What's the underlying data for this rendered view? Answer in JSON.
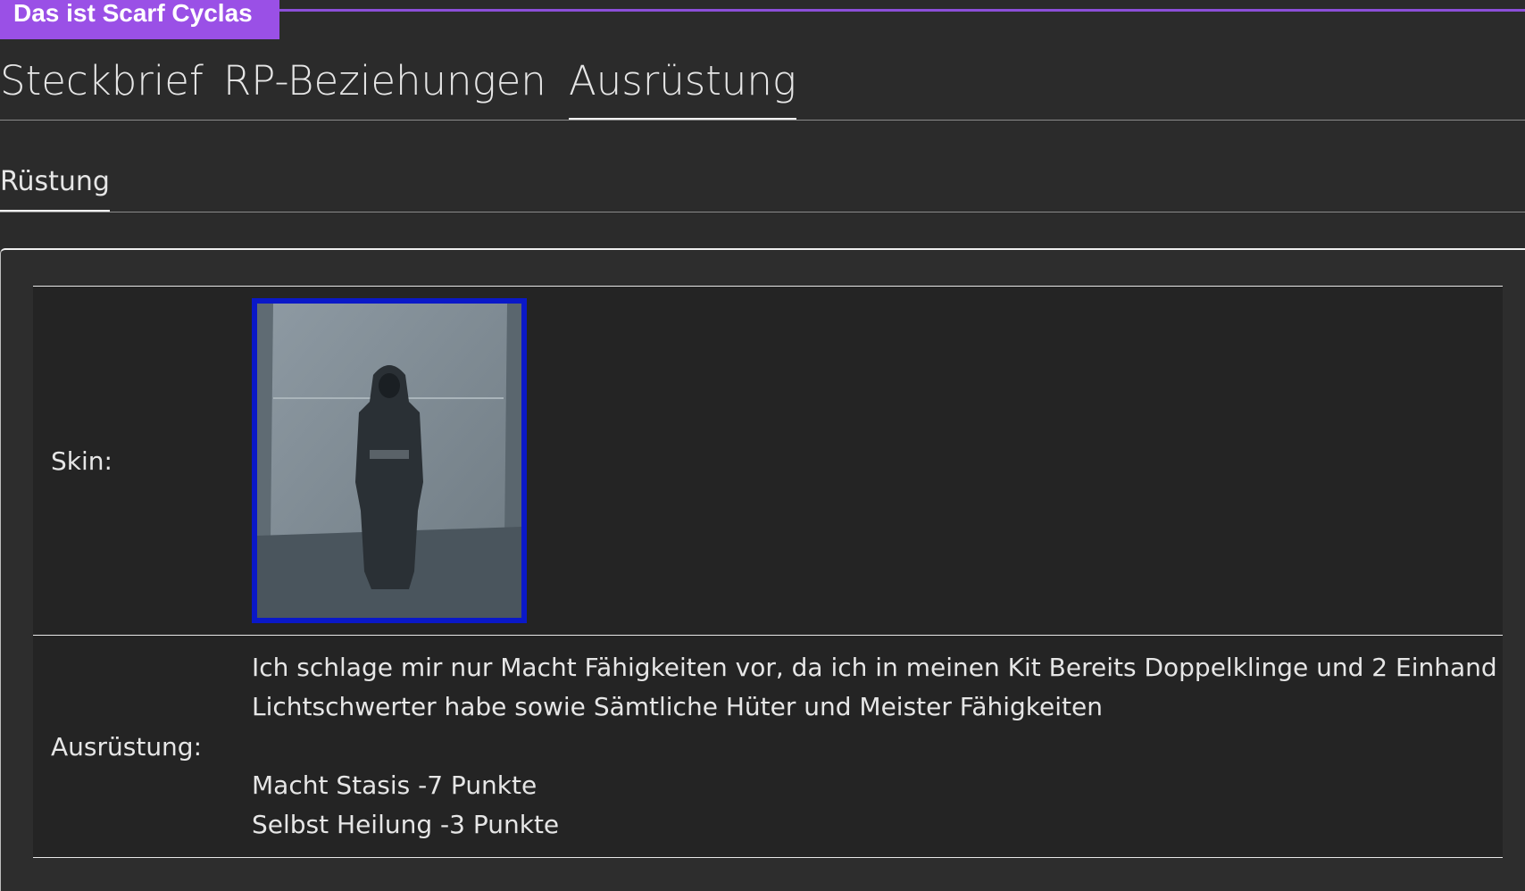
{
  "header": {
    "title": "Das ist Scarf Cyclas",
    "accent_color": "#9a50e6"
  },
  "tabs": [
    {
      "label": "Steckbrief",
      "active": false
    },
    {
      "label": "RP-Beziehungen",
      "active": false
    },
    {
      "label": "Ausrüstung",
      "active": true
    }
  ],
  "subtabs": [
    {
      "label": "Rüstung",
      "active": true
    }
  ],
  "table": {
    "skin_label": "Skin:",
    "skin_image_icon": "hooded-figure-skin-image",
    "skin_border_color": "#0a18c8",
    "equipment_label": "Ausrüstung:",
    "equipment_lines": [
      "Ich schlage mir nur Macht Fähigkeiten vor, da ich in meinen Kit Bereits Doppelklinge und 2 Einhand",
      "Lichtschwerter habe sowie Sämtliche Hüter und Meister Fähigkeiten",
      "Macht Stasis -7 Punkte",
      "Selbst Heilung -3 Punkte"
    ]
  }
}
